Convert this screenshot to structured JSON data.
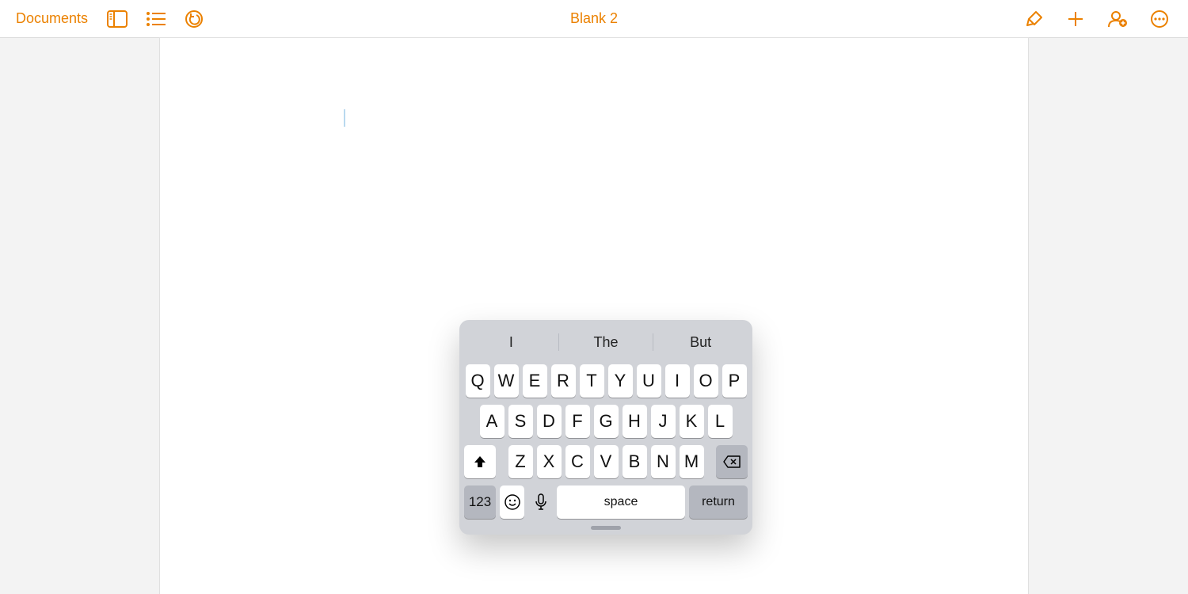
{
  "colors": {
    "accent": "#eb8100"
  },
  "toolbar": {
    "documents_label": "Documents",
    "title": "Blank 2"
  },
  "keyboard": {
    "predictions": [
      "I",
      "The",
      "But"
    ],
    "rows": {
      "r1": [
        "Q",
        "W",
        "E",
        "R",
        "T",
        "Y",
        "U",
        "I",
        "O",
        "P"
      ],
      "r2": [
        "A",
        "S",
        "D",
        "F",
        "G",
        "H",
        "J",
        "K",
        "L"
      ],
      "r3": [
        "Z",
        "X",
        "C",
        "V",
        "B",
        "N",
        "M"
      ]
    },
    "num_label": "123",
    "space_label": "space",
    "return_label": "return"
  }
}
